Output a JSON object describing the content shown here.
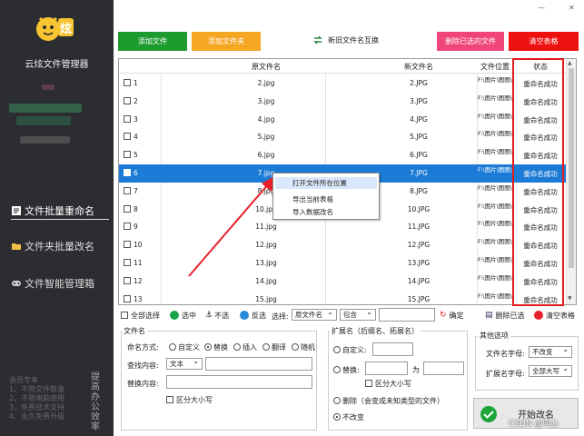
{
  "sidebar": {
    "app_title": "云炫文件管理器",
    "nav": [
      {
        "label": "文件批量重命名",
        "icon": "document-icon",
        "active": true
      },
      {
        "label": "文件夹批量改名",
        "icon": "folder-icon",
        "active": false
      },
      {
        "label": "文件智能管理箱",
        "icon": "gamepad-icon",
        "active": false
      }
    ],
    "member_title": "会员专享",
    "member_lines": [
      "1、不限文件数量",
      "2、不限电脑使用",
      "3、免费技术支持",
      "4、永久免费升级"
    ],
    "vertical_text": "提高办公效率"
  },
  "window": {
    "minimize": "—",
    "close": "✕"
  },
  "toolbar": {
    "add_file": "添加文件",
    "add_folder": "添加文件夹",
    "swap": "新旧文件名互换",
    "delete_selected": "删除已选的文件",
    "clear_table": "清空表格"
  },
  "table": {
    "headers": {
      "original": "原文件名",
      "new": "新文件名",
      "location": "文件位置",
      "status": "状态"
    },
    "rows": [
      {
        "idx": "1",
        "original": "2.jpg",
        "new": "2.JPG",
        "location": "F:\\图片\\图图\\",
        "status": "重命名成功"
      },
      {
        "idx": "2",
        "original": "3.jpg",
        "new": "3.JPG",
        "location": "F:\\图片\\图图\\",
        "status": "重命名成功"
      },
      {
        "idx": "3",
        "original": "4.jpg",
        "new": "4.JPG",
        "location": "F:\\图片\\图图\\",
        "status": "重命名成功"
      },
      {
        "idx": "4",
        "original": "5.jpg",
        "new": "5.JPG",
        "location": "F:\\图片\\图图\\",
        "status": "重命名成功"
      },
      {
        "idx": "5",
        "original": "6.jpg",
        "new": "6.JPG",
        "location": "F:\\图片\\图图\\",
        "status": "重命名成功"
      },
      {
        "idx": "6",
        "original": "7.jpg",
        "new": "7.JPG",
        "location": "F:\\图片\\图图\\",
        "status": "重命名成功",
        "selected": true
      },
      {
        "idx": "7",
        "original": "8.jpg",
        "new": "8.JPG",
        "location": "F:\\图片\\图图\\",
        "status": "重命名成功"
      },
      {
        "idx": "8",
        "original": "10.jpg",
        "new": "10.JPG",
        "location": "F:\\图片\\图图\\",
        "status": "重命名成功"
      },
      {
        "idx": "9",
        "original": "11.jpg",
        "new": "11.JPG",
        "location": "F:\\图片\\图图\\",
        "status": "重命名成功"
      },
      {
        "idx": "10",
        "original": "12.jpg",
        "new": "12.JPG",
        "location": "F:\\图片\\图图\\",
        "status": "重命名成功"
      },
      {
        "idx": "11",
        "original": "13.jpg",
        "new": "13.JPG",
        "location": "F:\\图片\\图图\\",
        "status": "重命名成功"
      },
      {
        "idx": "12",
        "original": "14.jpg",
        "new": "14.JPG",
        "location": "F:\\图片\\图图\\",
        "status": "重命名成功"
      },
      {
        "idx": "13",
        "original": "15.jpg",
        "new": "15.JPG",
        "location": "F:\\图片\\图图\\",
        "status": "重命名成功"
      }
    ]
  },
  "context_menu": {
    "items": [
      "打开文件所在位置",
      "导出当前表格",
      "导入数据改名"
    ]
  },
  "bottom_bar": {
    "select_all": "全部选择",
    "select": "选中",
    "unselect": "不选",
    "invert": "反选",
    "choose_label": "选择:",
    "field_option": "原文件名",
    "match_option": "包含",
    "confirm": "确定",
    "delete_selected": "删除已选",
    "clear_table": "清空表格"
  },
  "filename_panel": {
    "title": "文件名",
    "mode_label": "命名方式:",
    "modes": [
      "自定义",
      "替换",
      "插入",
      "翻译",
      "随机"
    ],
    "find_label": "查找内容:",
    "find_type": "文本",
    "replace_label": "替换内容:",
    "case_label": "区分大小写"
  },
  "ext_panel": {
    "title": "扩展名（后缀名、拓展名）",
    "custom": "自定义:",
    "replace": "替换:",
    "as": "为",
    "case_label": "区分大小写",
    "delete": "删除（会变成未知类型的文件）",
    "unchanged": "不改变"
  },
  "other_panel": {
    "title": "其他选项",
    "file_case_label": "文件名字母:",
    "file_case_value": "不改变",
    "ext_case_label": "扩展名字母:",
    "ext_case_value": "全部大写"
  },
  "start_button": "开始改名",
  "watermark": "CSDN @叫心"
}
